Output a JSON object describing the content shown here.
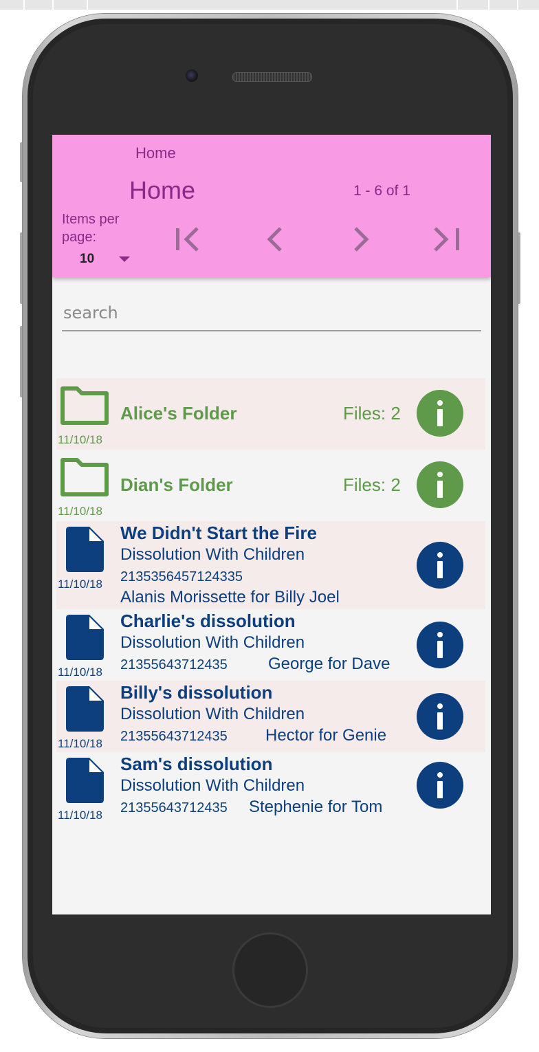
{
  "header": {
    "breadcrumb": "Home",
    "title": "Home",
    "range_label": "1 - 6 of 1",
    "items_per_page_label": "Items per page:",
    "items_per_page_value": "10"
  },
  "search": {
    "placeholder": "search",
    "value": ""
  },
  "folders": [
    {
      "name": "Alice's Folder",
      "files": "Files: 2",
      "date": "11/10/18"
    },
    {
      "name": "Dian's Folder",
      "files": "Files: 2",
      "date": "11/10/18"
    }
  ],
  "documents": [
    {
      "name": "We Didn't Start the Fire",
      "type": "Dissolution With Children",
      "number": "2135356457124335",
      "parties": "Alanis Morissette for Billy Joel",
      "date": "11/10/18"
    },
    {
      "name": "Charlie's dissolution",
      "type": "Dissolution With Children",
      "number": "21355643712435",
      "parties": "George for Dave",
      "date": "11/10/18"
    },
    {
      "name": "Billy's dissolution",
      "type": "Dissolution With Children",
      "number": "21355643712435",
      "parties": "Hector for Genie",
      "date": "11/10/18"
    },
    {
      "name": "Sam's dissolution",
      "type": "Dissolution With Children",
      "number": "21355643712435",
      "parties": "Stephenie for Tom",
      "date": "11/10/18"
    }
  ],
  "colors": {
    "header_bg": "#f89ae4",
    "header_text": "#8b2a86",
    "folder_green": "#5e9a4a",
    "document_blue": "#0d3f7f",
    "row_alt_bg": "#f5ebea"
  },
  "icons": {
    "first_page": "first-page-icon",
    "prev_page": "chevron-left-icon",
    "next_page": "chevron-right-icon",
    "last_page": "last-page-icon",
    "folder": "folder-icon",
    "document": "document-icon",
    "info": "info-icon"
  }
}
